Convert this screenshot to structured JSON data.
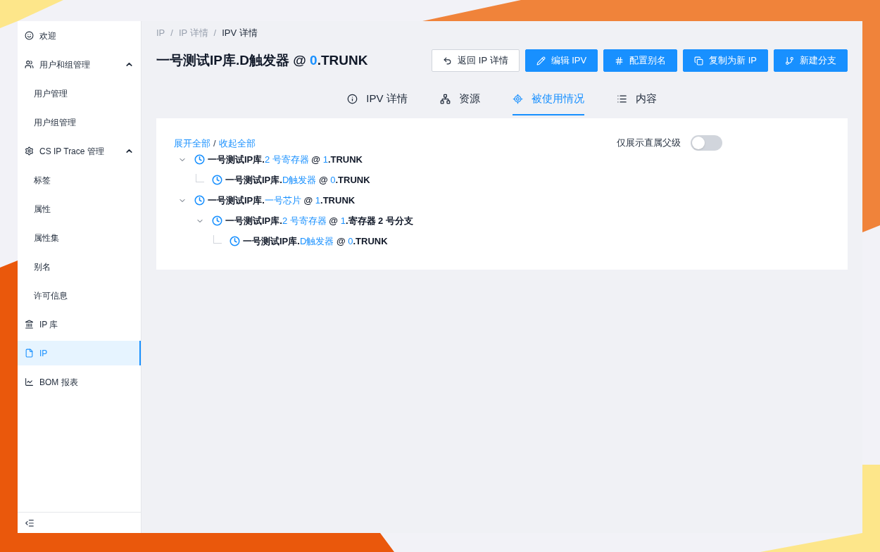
{
  "sidebar": {
    "items": [
      {
        "kind": "item",
        "label": "欢迎",
        "selected": false
      },
      {
        "kind": "group",
        "label": "用户和组管理",
        "expanded": true,
        "children": [
          {
            "label": "用户管理",
            "selected": false
          },
          {
            "label": "用户组管理",
            "selected": false
          }
        ]
      },
      {
        "kind": "group",
        "label": "CS IP Trace 管理",
        "expanded": true,
        "children": [
          {
            "label": "标签",
            "selected": false
          },
          {
            "label": "属性",
            "selected": false
          },
          {
            "label": "属性集",
            "selected": false
          },
          {
            "label": "别名",
            "selected": false
          },
          {
            "label": "许可信息",
            "selected": false
          }
        ]
      },
      {
        "kind": "item",
        "label": "IP 库",
        "selected": false
      },
      {
        "kind": "item",
        "label": "IP",
        "selected": true
      },
      {
        "kind": "item",
        "label": "BOM 报表",
        "selected": false
      }
    ]
  },
  "breadcrumb": [
    "IP",
    "IP 详情",
    "IPV 详情"
  ],
  "breadcrumb_separators": [
    "/",
    "/"
  ],
  "title": {
    "library": "一号测试IP库.D触发器 @ ",
    "version": "0",
    "branch": ".TRUNK"
  },
  "actions": [
    {
      "label": "返回 IP 详情",
      "kind": "secondary"
    },
    {
      "label": "编辑 IPV",
      "kind": "primary"
    },
    {
      "label": "配置别名",
      "kind": "primary"
    },
    {
      "label": "复制为新 IP",
      "kind": "primary"
    },
    {
      "label": "新建分支",
      "kind": "primary"
    }
  ],
  "tabs": [
    {
      "label": "IPV 详情",
      "selected": false
    },
    {
      "label": "资源",
      "selected": false
    },
    {
      "label": "被使用情况",
      "selected": true
    },
    {
      "label": "内容",
      "selected": false
    }
  ],
  "tree_controls": {
    "expand_all": "展开全部",
    "separator": "/",
    "collapse_all": "收起全部"
  },
  "direct_parent_toggle": {
    "label": "仅展示直属父级",
    "on": false
  },
  "tree": [
    {
      "library": "一号测试IP库.",
      "name": "2 号寄存器",
      "at": " @ ",
      "version": "1",
      "branch": ".TRUNK",
      "expanded": true,
      "children": [
        {
          "library": "一号测试IP库.",
          "name": "D触发器",
          "at": " @ ",
          "version": "0",
          "branch": ".TRUNK"
        }
      ]
    },
    {
      "library": "一号测试IP库.",
      "name": "一号芯片",
      "at": " @ ",
      "version": "1",
      "branch": ".TRUNK",
      "expanded": true,
      "children": [
        {
          "library": "一号测试IP库.",
          "name": "2 号寄存器",
          "at": " @ ",
          "version": "1",
          "branch": ".寄存器 2 号分支",
          "expanded": true,
          "children": [
            {
              "library": "一号测试IP库.",
              "name": "D触发器",
              "at": " @ ",
              "version": "0",
              "branch": ".TRUNK"
            }
          ]
        }
      ]
    }
  ]
}
